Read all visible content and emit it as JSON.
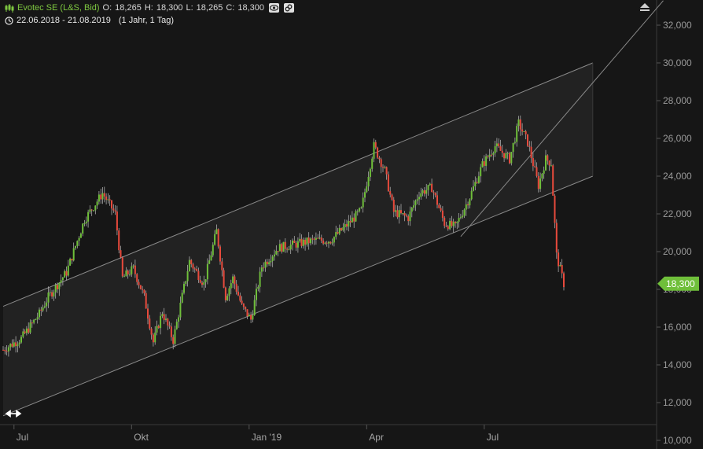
{
  "header": {
    "title": "Evotec SE (L&S, Bid)",
    "ohlc": [
      {
        "label": "O:",
        "value": "18,265"
      },
      {
        "label": "H:",
        "value": "18,300"
      },
      {
        "label": "L:",
        "value": "18,265"
      },
      {
        "label": "C:",
        "value": "18,300"
      }
    ],
    "date_range": "22.06.2018 - 21.08.2019",
    "period": "(1 Jahr, 1 Tag)",
    "icons": [
      "candlestick-icon",
      "eye-icon",
      "link-icon",
      "clock-icon",
      "expand-arrows-icon",
      "collapse-up-icon"
    ]
  },
  "colors": {
    "background": "#161616",
    "up": "#6fbf3a",
    "down": "#e84a3c",
    "channel": "#8a8a8a",
    "last_price_badge": "#6fbf3a"
  },
  "chart_data": {
    "type": "candlestick",
    "y_axis": {
      "position": "right",
      "ticks": [
        "32,000",
        "30,000",
        "28,000",
        "26,000",
        "24,000",
        "22,000",
        "20,000",
        "18,000",
        "16,000",
        "14,000",
        "12,000",
        "10,000"
      ],
      "ylim": [
        10,
        33.3
      ]
    },
    "x_axis": {
      "ticks": [
        {
          "label": "Jul",
          "index": 6
        },
        {
          "label": "Okt",
          "index": 71
        },
        {
          "label": "Jan '19",
          "index": 136
        },
        {
          "label": "Apr",
          "index": 201
        },
        {
          "label": "Jul",
          "index": 266
        }
      ],
      "count": 300
    },
    "last_price": "18,300",
    "grid": false,
    "price_path": [
      [
        0,
        14.8
      ],
      [
        10,
        15.4
      ],
      [
        20,
        16.7
      ],
      [
        25,
        17.6
      ],
      [
        35,
        18.9
      ],
      [
        45,
        21.7
      ],
      [
        55,
        23.1
      ],
      [
        62,
        22.0
      ],
      [
        66,
        18.6
      ],
      [
        72,
        19.1
      ],
      [
        78,
        17.6
      ],
      [
        83,
        15.2
      ],
      [
        88,
        16.8
      ],
      [
        94,
        15.3
      ],
      [
        103,
        19.5
      ],
      [
        111,
        18.3
      ],
      [
        118,
        21.1
      ],
      [
        123,
        17.6
      ],
      [
        127,
        18.6
      ],
      [
        132,
        17.1
      ],
      [
        137,
        16.4
      ],
      [
        143,
        19.2
      ],
      [
        152,
        20.2
      ],
      [
        162,
        20.4
      ],
      [
        172,
        20.6
      ],
      [
        181,
        20.6
      ],
      [
        190,
        21.4
      ],
      [
        198,
        22.2
      ],
      [
        205,
        25.6
      ],
      [
        211,
        24.3
      ],
      [
        216,
        22.1
      ],
      [
        224,
        21.8
      ],
      [
        230,
        23.1
      ],
      [
        237,
        23.4
      ],
      [
        244,
        21.5
      ],
      [
        250,
        21.3
      ],
      [
        258,
        22.9
      ],
      [
        265,
        24.6
      ],
      [
        272,
        25.6
      ],
      [
        280,
        24.9
      ],
      [
        285,
        26.8
      ],
      [
        290,
        25.8
      ],
      [
        296,
        23.5
      ],
      [
        300,
        24.9
      ],
      [
        303,
        24.7
      ],
      [
        306,
        19.8
      ],
      [
        310,
        18.3
      ]
    ],
    "channel": {
      "upper": [
        [
          0,
          17.1
        ],
        [
          326,
          30.0
        ]
      ],
      "lower": [
        [
          0,
          11.3
        ],
        [
          326,
          24.0
        ]
      ]
    },
    "trendline": [
      [
        253,
        20.8
      ],
      [
        365,
        33.3
      ]
    ]
  }
}
